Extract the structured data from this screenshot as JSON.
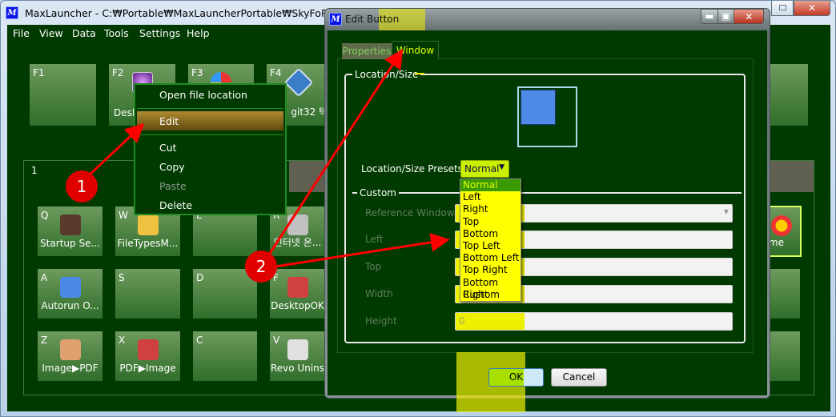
{
  "main_window": {
    "title": "MaxLauncher - C:₩Portable₩MaxLauncherPortable₩SkyFoRain.mld",
    "menu": [
      "File",
      "View",
      "Data",
      "Tools",
      "Settings",
      "Help"
    ],
    "function_tiles": [
      {
        "key": "F1",
        "label": ""
      },
      {
        "key": "F2",
        "label": "Desk"
      },
      {
        "key": "F3",
        "label": ""
      },
      {
        "key": "F4",
        "label": "git32 텍."
      }
    ],
    "group_label": "1",
    "tiles": [
      [
        {
          "key": "Q",
          "label": "Startup Se..."
        },
        {
          "key": "W",
          "label": "FileTypesM..."
        },
        {
          "key": "E",
          "label": ""
        },
        {
          "key": "R",
          "label": "인터넷 온..."
        }
      ],
      [
        {
          "key": "A",
          "label": "Autorun O..."
        },
        {
          "key": "S",
          "label": ""
        },
        {
          "key": "D",
          "label": ""
        },
        {
          "key": "F",
          "label": "DesktopOK"
        }
      ],
      [
        {
          "key": "Z",
          "label": "Image▶PDF"
        },
        {
          "key": "X",
          "label": "PDF▶Image"
        },
        {
          "key": "C",
          "label": ""
        },
        {
          "key": "V",
          "label": "Revo Unins"
        }
      ]
    ],
    "right_tile_label": "me"
  },
  "context_menu": {
    "items": [
      {
        "label": "Open file location",
        "state": "normal"
      },
      {
        "label": "Edit",
        "state": "highlighted"
      },
      {
        "label": "Cut",
        "state": "normal"
      },
      {
        "label": "Copy",
        "state": "normal"
      },
      {
        "label": "Paste",
        "state": "disabled"
      },
      {
        "label": "Delete",
        "state": "normal"
      }
    ]
  },
  "dialog": {
    "title": "Edit Button",
    "tabs": [
      {
        "label": "Properties",
        "active": false
      },
      {
        "label": "Window",
        "active": true
      }
    ],
    "location_size_group": "Location/Size",
    "presets_label": "Location/Size Presets:",
    "presets_value": "Normal",
    "presets_options": [
      "Normal",
      "Left",
      "Right",
      "Top",
      "Bottom",
      "Top Left",
      "Bottom Left",
      "Top Right",
      "Bottom Right",
      "Custom"
    ],
    "custom_group": "Custom",
    "fields": [
      {
        "label": "Reference Window:",
        "value": ""
      },
      {
        "label": "Left",
        "value": ""
      },
      {
        "label": "Top",
        "value": ""
      },
      {
        "label": "Width",
        "value": ""
      },
      {
        "label": "Height",
        "value": "0"
      }
    ],
    "ok_label": "OK",
    "cancel_label": "Cancel"
  },
  "annotations": [
    "1",
    "2"
  ],
  "colors": {
    "background": "#003a00",
    "tile": "#4f8444",
    "highlight": "#eef000",
    "annotation": "#e00000",
    "menu_highlight": "#8a6a20"
  }
}
